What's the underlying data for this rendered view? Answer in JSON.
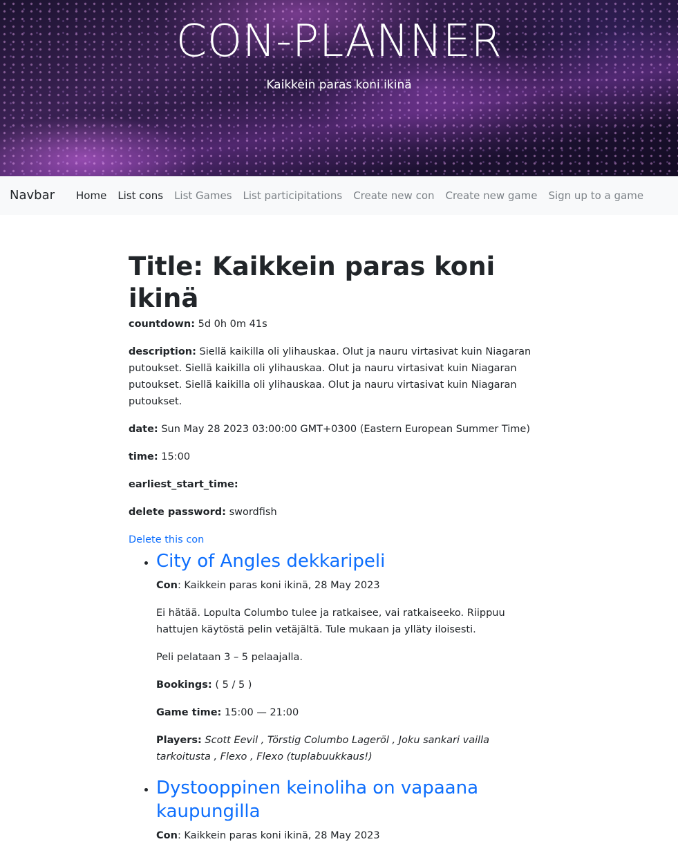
{
  "header": {
    "title": "CON-PLANNER",
    "subtitle": "Kaikkein paras koni ikinä"
  },
  "navbar": {
    "brand": "Navbar",
    "links": [
      {
        "label": "Home",
        "active": true
      },
      {
        "label": "List cons",
        "active": true
      },
      {
        "label": "List Games",
        "active": false
      },
      {
        "label": "List participitations",
        "active": false
      },
      {
        "label": "Create new con",
        "active": false
      },
      {
        "label": "Create new game",
        "active": false
      },
      {
        "label": "Sign up to a game",
        "active": false
      }
    ]
  },
  "con": {
    "title": "Title: Kaikkein paras koni ikinä",
    "countdown_label": "countdown:",
    "countdown": "5d 0h 0m 41s",
    "description_label": "description:",
    "description": "Siellä kaikilla oli ylihauskaa. Olut ja nauru virtasivat kuin Niagaran putoukset. Siellä kaikilla oli ylihauskaa. Olut ja nauru virtasivat kuin Niagaran putoukset. Siellä kaikilla oli ylihauskaa. Olut ja nauru virtasivat kuin Niagaran putoukset.",
    "date_label": "date:",
    "date": "Sun May 28 2023 03:00:00 GMT+0300 (Eastern European Summer Time)",
    "time_label": "time:",
    "time": "15:00",
    "earliest_label": "earliest_start_time:",
    "earliest": "",
    "password_label": "delete password:",
    "password": "swordfish",
    "delete_link": "Delete this con"
  },
  "games": [
    {
      "title": "City of Angles dekkaripeli",
      "con_label": "Con",
      "con": ": Kaikkein paras koni ikinä, 28 May 2023",
      "description": "Ei hätää. Lopulta Columbo tulee ja ratkaisee, vai ratkaiseeko. Riippuu hattujen käytöstä pelin vetäjältä. Tule mukaan ja ylläty iloisesti.",
      "players_count": "Peli pelataan 3 – 5 pelaajalla.",
      "bookings_label": "Bookings:",
      "bookings": " ( 5 / 5 )",
      "gametime_label": "Game time:",
      "gametime": " 15:00 — 21:00",
      "players_label": "Players:",
      "players": " Scott Eevil , Törstig Columbo Lageröl , Joku sankari vailla tarkoitusta , Flexo , Flexo (tuplabuukkaus!)"
    },
    {
      "title": "Dystooppinen keinoliha on vapaana kaupungilla",
      "con_label": "Con",
      "con": ": Kaikkein paras koni ikinä, 28 May 2023"
    }
  ]
}
